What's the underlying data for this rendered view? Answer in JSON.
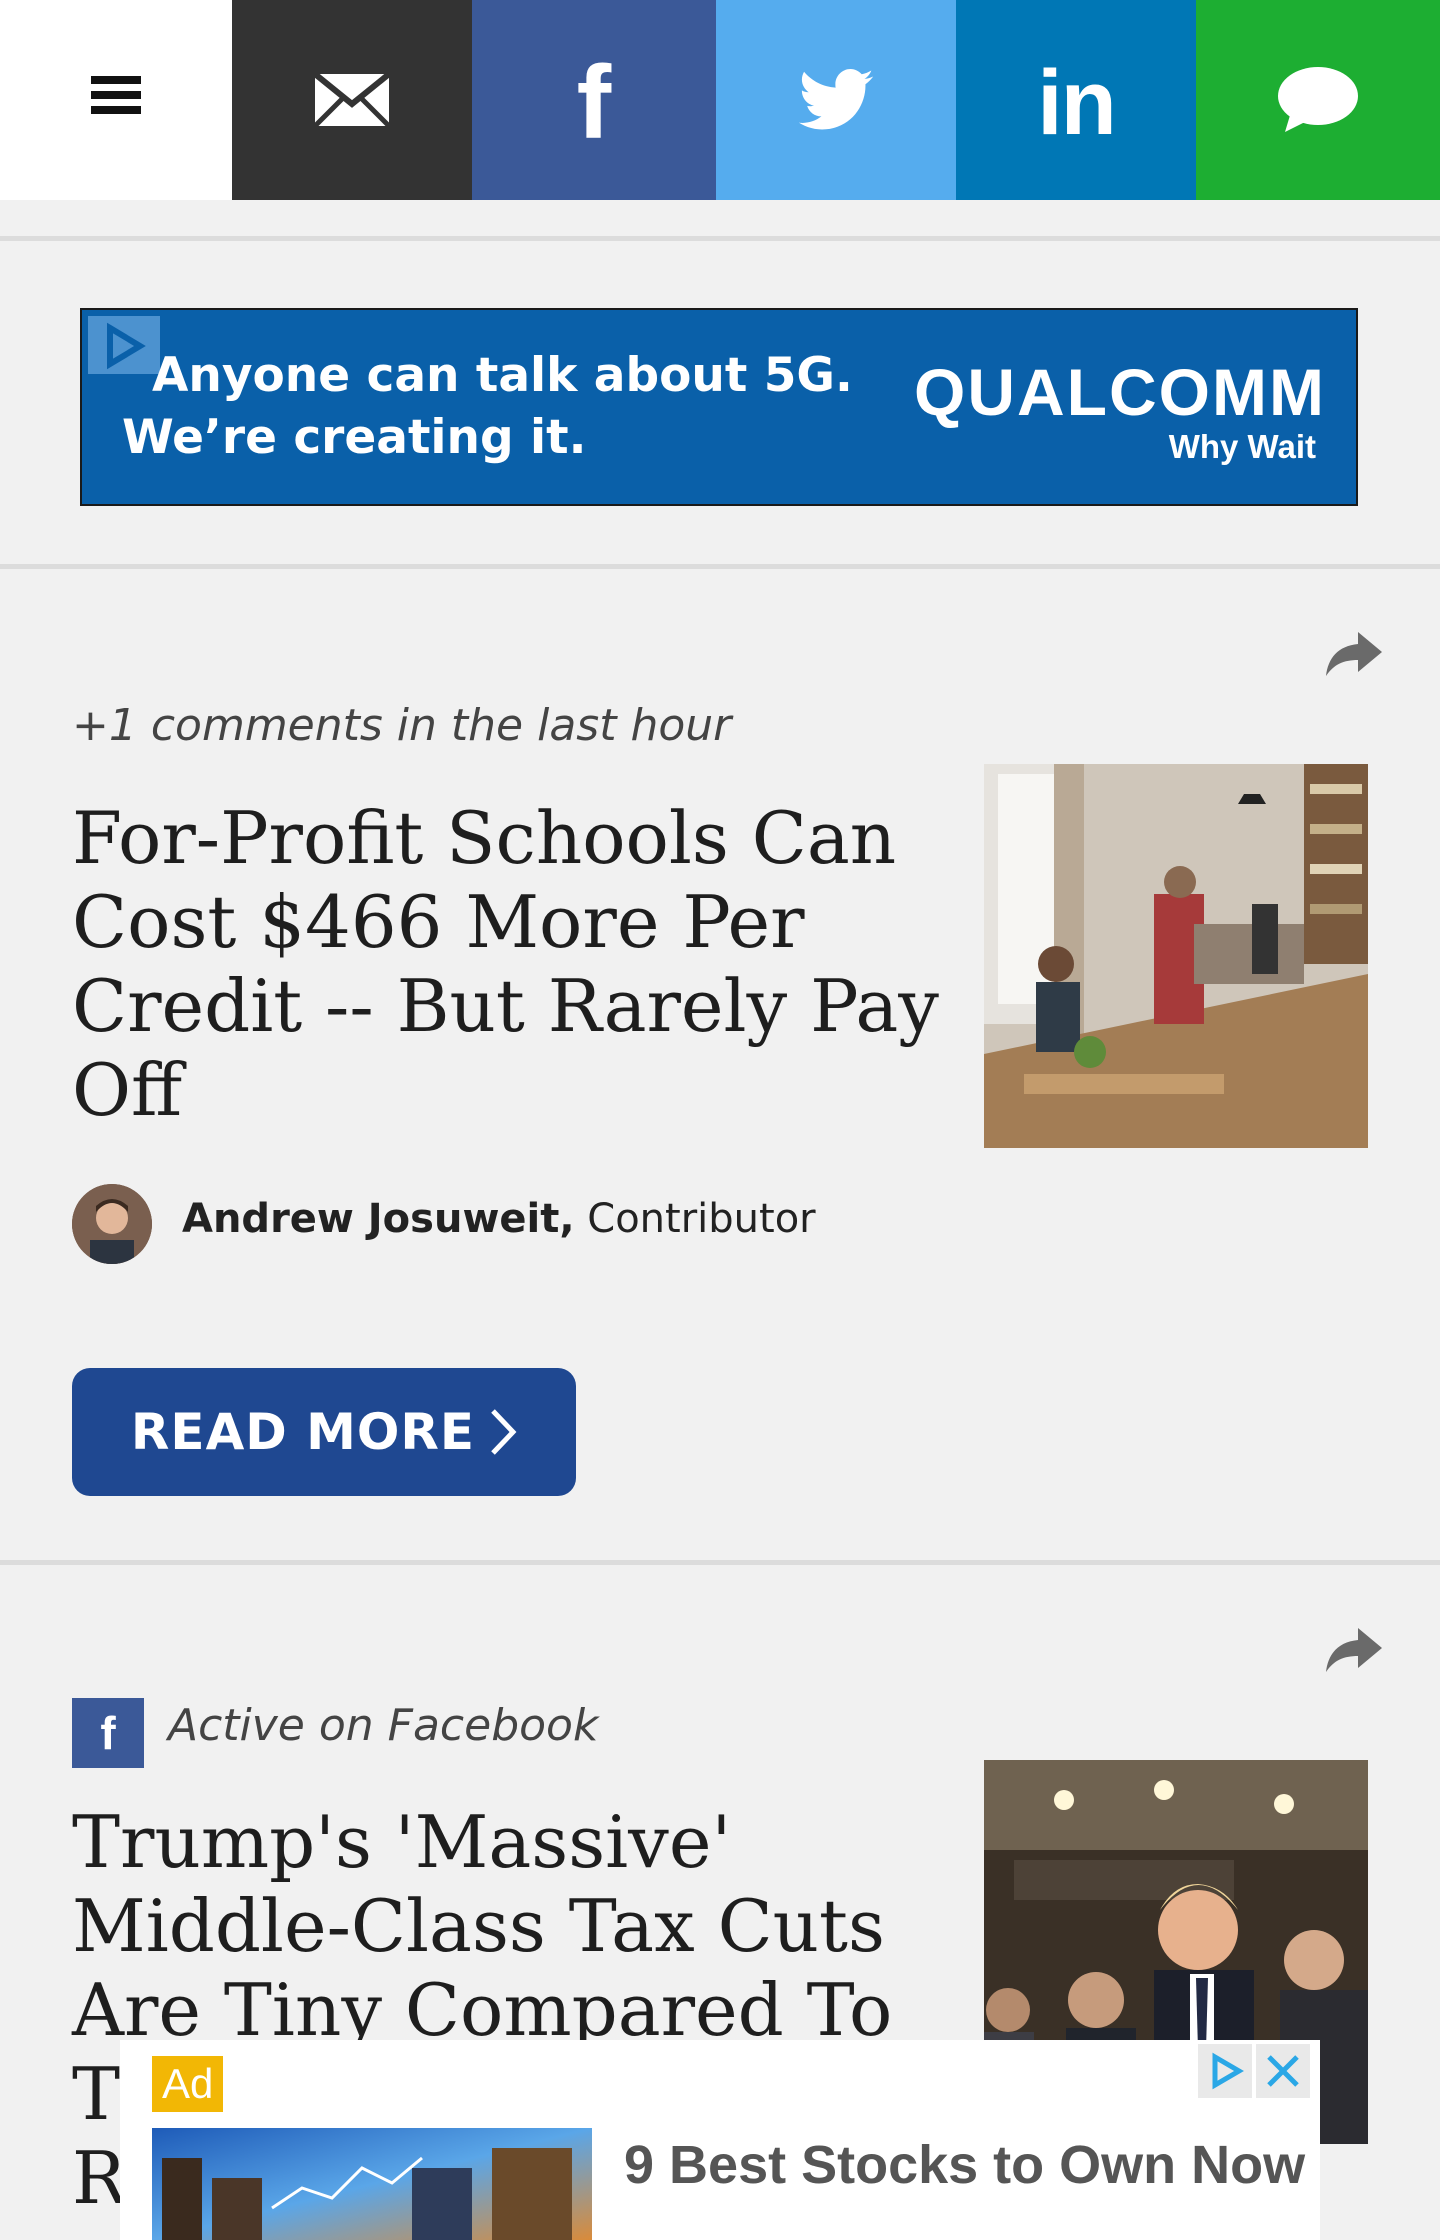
{
  "topbar": {
    "menu_icon": "hamburger-menu-icon",
    "share_buttons": [
      {
        "icon": "email-icon",
        "color": "#333333"
      },
      {
        "icon": "facebook-icon",
        "color": "#3b5998"
      },
      {
        "icon": "twitter-icon",
        "color": "#55acee"
      },
      {
        "icon": "linkedin-icon",
        "color": "#0077b5"
      },
      {
        "icon": "sms-chat-icon",
        "color": "#1dae32"
      }
    ],
    "fb_glyph": "f",
    "li_glyph": "in"
  },
  "banner_ad": {
    "line1": "Anyone can talk about 5G.",
    "line2": "We’re creating it.",
    "brand": "QUALCOMM",
    "tagline": "Why Wait",
    "background": "#0a60a9"
  },
  "articles": [
    {
      "meta": "+1 comments in the last hour",
      "title": "For-Profit Schools Can Cost $466 More Per Credit -- But Rarely Pay Off",
      "author": "Andrew Josuweit,",
      "role": " Contributor",
      "read_more": "READ MORE",
      "thumbnail_icon": "office-photo"
    },
    {
      "meta": "Active on Facebook",
      "meta_badge": "f",
      "title": "Trump's 'Massive' Middle-Class Tax Cuts Are Tiny Compared To T",
      "title_tail": "R",
      "thumbnail_icon": "trump-photo"
    }
  ],
  "overlay_ad": {
    "label": "Ad",
    "headline": "9 Best Stocks to Own Now",
    "label_color": "#f2b705"
  },
  "colors": {
    "page_bg": "#f1f1f1",
    "button": "#1f4891",
    "title_text": "#1e1e1e"
  }
}
